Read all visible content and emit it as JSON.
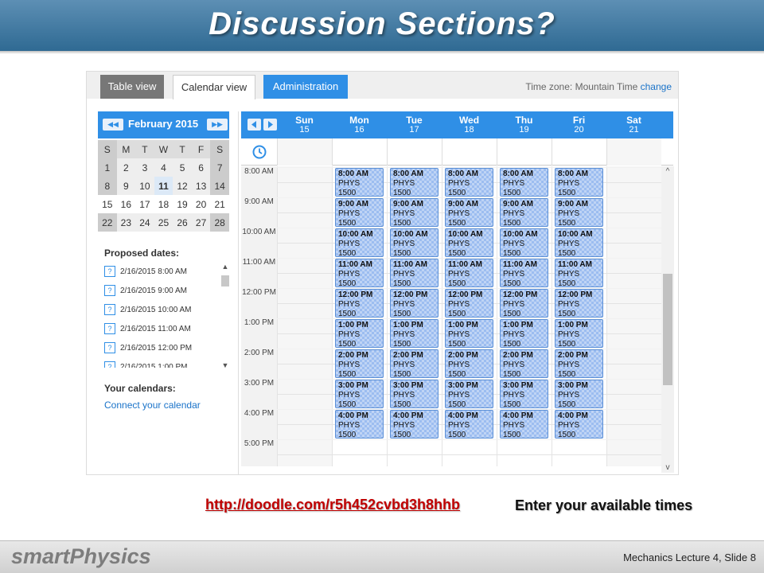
{
  "slide": {
    "title": "Discussion Sections?",
    "link": "http://doodle.com/r5h452cvbd3h8hhb",
    "instruction": "Enter your available times",
    "footer_logo": "smartPhysics",
    "footer_text": "Mechanics  Lecture 4, Slide 8"
  },
  "tabs": {
    "table": "Table view",
    "calendar": "Calendar view",
    "admin": "Administration",
    "timezone_label": "Time zone: Mountain Time",
    "timezone_change": "change"
  },
  "mini_calendar": {
    "month_label": "February 2015",
    "prev_icon": "◀◀",
    "next_icon": "▶▶",
    "weekdays": [
      "S",
      "M",
      "T",
      "W",
      "T",
      "F",
      "S"
    ],
    "weeks": [
      [
        "1",
        "2",
        "3",
        "4",
        "5",
        "6",
        "7"
      ],
      [
        "8",
        "9",
        "10",
        "11",
        "12",
        "13",
        "14"
      ],
      [
        "15",
        "16",
        "17",
        "18",
        "19",
        "20",
        "21"
      ],
      [
        "22",
        "23",
        "24",
        "25",
        "26",
        "27",
        "28"
      ]
    ],
    "today": "11"
  },
  "proposed": {
    "title": "Proposed dates:",
    "items": [
      "2/16/2015 8:00 AM",
      "2/16/2015 9:00 AM",
      "2/16/2015 10:00 AM",
      "2/16/2015 11:00 AM",
      "2/16/2015 12:00 PM",
      "2/16/2015 1:00 PM"
    ],
    "badge": "?"
  },
  "your_calendars": {
    "title": "Your calendars:",
    "connect": "Connect your calendar"
  },
  "week": {
    "days": [
      {
        "name": "Sun",
        "num": "15"
      },
      {
        "name": "Mon",
        "num": "16"
      },
      {
        "name": "Tue",
        "num": "17"
      },
      {
        "name": "Wed",
        "num": "18"
      },
      {
        "name": "Thu",
        "num": "19"
      },
      {
        "name": "Fri",
        "num": "20"
      },
      {
        "name": "Sat",
        "num": "21"
      }
    ],
    "times": [
      "8:00 AM",
      "9:00 AM",
      "10:00 AM",
      "11:00 AM",
      "12:00 PM",
      "1:00 PM",
      "2:00 PM",
      "3:00 PM",
      "4:00 PM",
      "5:00 PM"
    ],
    "slot_times": [
      "8:00 AM",
      "9:00 AM",
      "10:00 AM",
      "11:00 AM",
      "12:00 PM",
      "1:00 PM",
      "2:00 PM",
      "3:00 PM",
      "4:00 PM"
    ],
    "slot_course": "PHYS",
    "slot_number": "1500",
    "slot_days": [
      1,
      2,
      3,
      4,
      5
    ]
  },
  "colors": {
    "accent": "#2f8fe6",
    "title_bar": "#3f77a0",
    "link": "#c00000",
    "slot": "#9cbdf0"
  }
}
